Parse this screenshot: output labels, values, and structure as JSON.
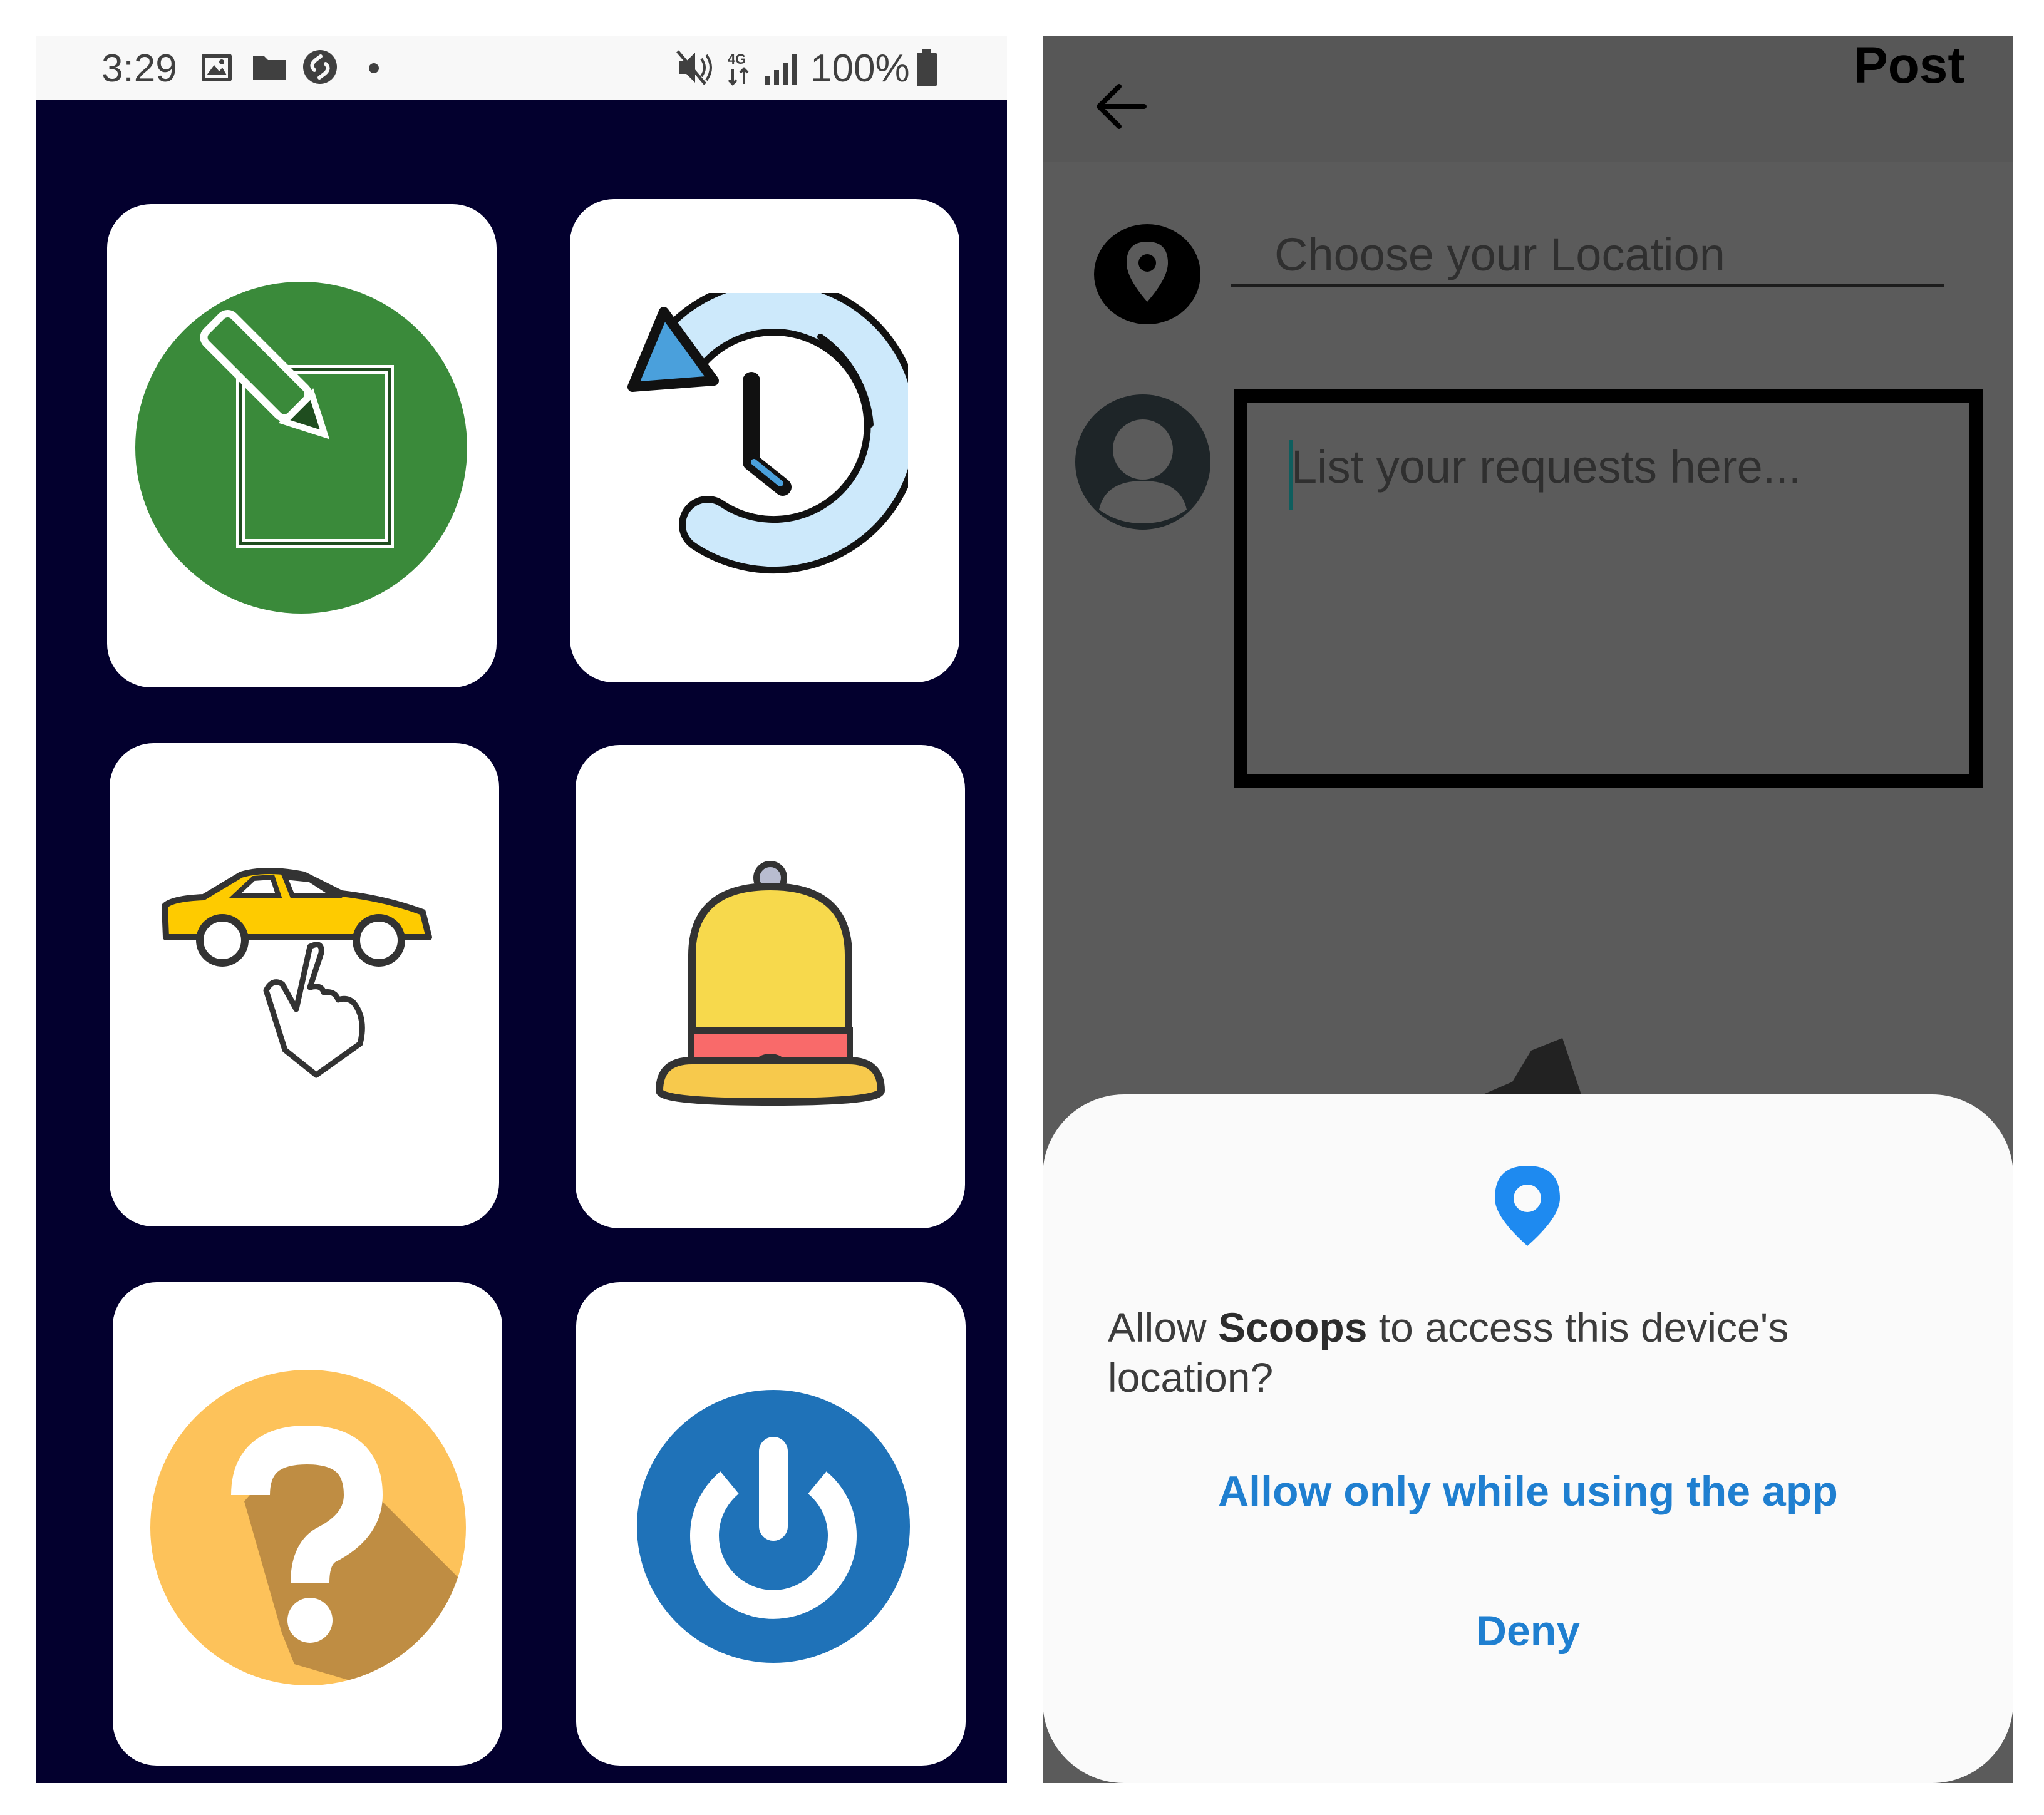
{
  "status_bar": {
    "time": "3:29",
    "battery": "100%",
    "icons": [
      "gallery-icon",
      "folder-icon",
      "shazam-icon",
      "notification-dot-icon",
      "mute-icon",
      "4g-icon",
      "signal-icon",
      "battery-icon"
    ]
  },
  "dashboard": {
    "background": "#03002e",
    "tiles": [
      {
        "icon": "edit-note-icon"
      },
      {
        "icon": "history-icon"
      },
      {
        "icon": "ride-car-icon"
      },
      {
        "icon": "bell-icon"
      },
      {
        "icon": "help-icon"
      },
      {
        "icon": "power-icon"
      }
    ]
  },
  "post_screen": {
    "title": "Post",
    "back_icon": "arrow-left-icon",
    "location_placeholder": "Choose your Location",
    "requests_placeholder": "List your requests here..."
  },
  "permission_dialog": {
    "icon": "location-pin-icon",
    "message_prefix": "Allow ",
    "app_name": "Scoops",
    "message_suffix": " to access this device's location?",
    "allow_label": "Allow only while using the app",
    "deny_label": "Deny",
    "accent": "#1f7fd0"
  }
}
